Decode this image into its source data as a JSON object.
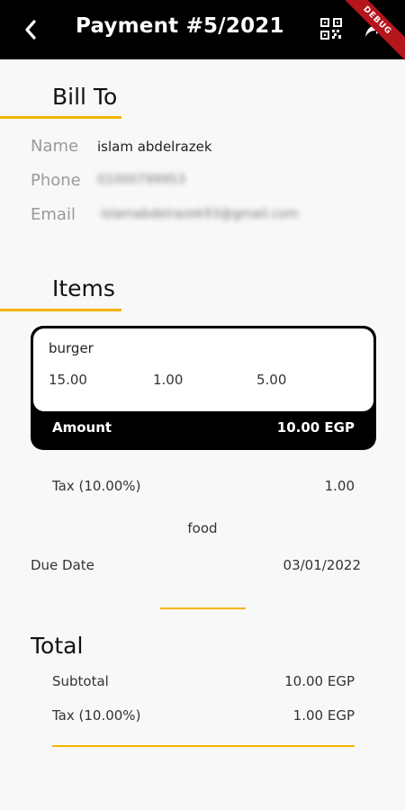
{
  "appbar": {
    "title": "Payment #5/2021",
    "debug_label": "DEBUG",
    "icons": [
      "back-arrow-icon",
      "qr-code-icon",
      "share-icon"
    ]
  },
  "bill_to": {
    "heading": "Bill To",
    "name_label": "Name",
    "name_value": "islam abdelrazek",
    "phone_label": "Phone",
    "phone_value": "01000799953",
    "email_label": "Email",
    "email_value": "islamabdelrazek93@gmail.com"
  },
  "items": {
    "heading": "Items",
    "list": [
      {
        "name": "burger",
        "price": "15.00",
        "quantity": "1.00",
        "discount": "5.00",
        "amount_label": "Amount",
        "amount_value": "10.00 EGP"
      }
    ]
  },
  "tax_line": {
    "label": "Tax (10.00%)",
    "value": "1.00"
  },
  "note": "food",
  "due_date": {
    "label": "Due Date",
    "value": "03/01/2022"
  },
  "total": {
    "heading": "Total",
    "subtotal_label": "Subtotal",
    "subtotal_value": "10.00 EGP",
    "tax_label": "Tax (10.00%)",
    "tax_value": "1.00 EGP"
  },
  "colors": {
    "accent": "#f4b400",
    "appbar": "#000000",
    "background": "#f8f8f8",
    "debug_ribbon": "#b5161c"
  }
}
